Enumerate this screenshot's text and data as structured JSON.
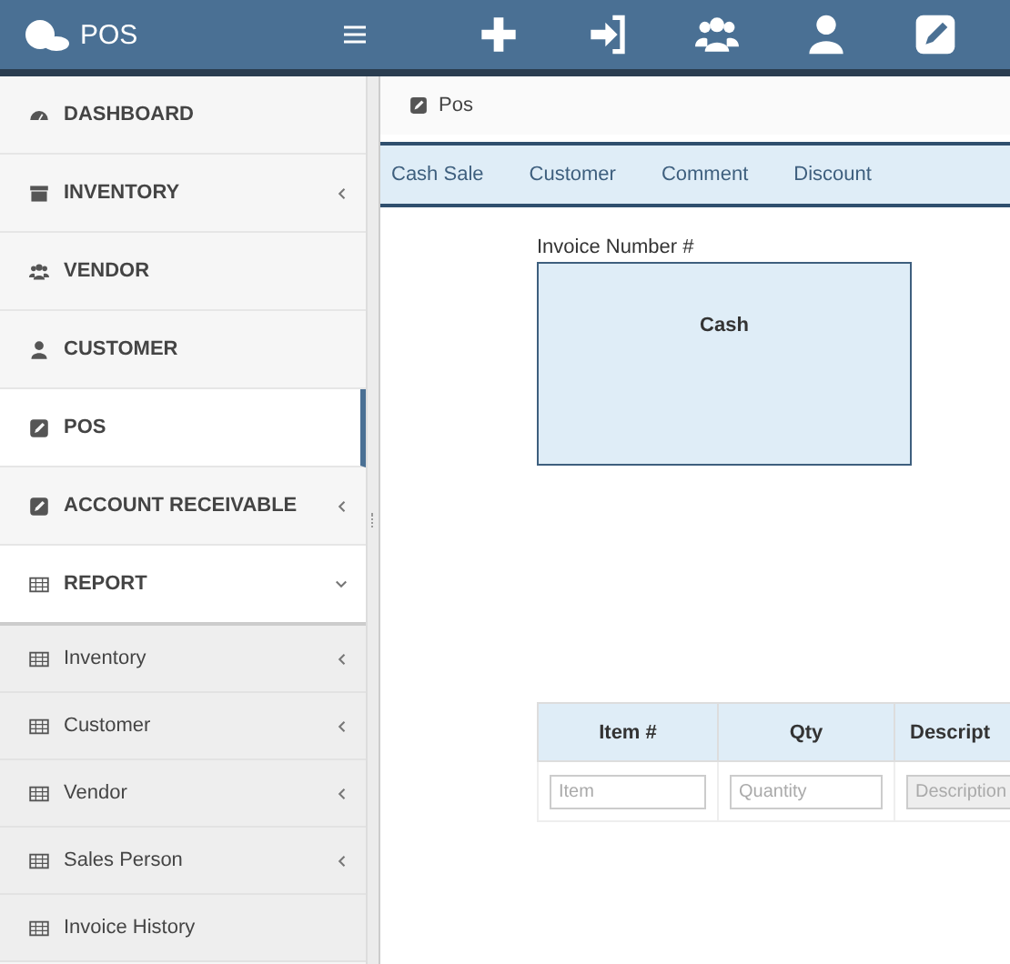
{
  "header": {
    "brand": "POS"
  },
  "sidebar": {
    "items": [
      {
        "label": "DASHBOARD",
        "selected": false,
        "submenu": false
      },
      {
        "label": "INVENTORY",
        "selected": false,
        "submenu": true,
        "expanded": false
      },
      {
        "label": "VENDOR",
        "selected": false,
        "submenu": false
      },
      {
        "label": "CUSTOMER",
        "selected": false,
        "submenu": false
      },
      {
        "label": "POS",
        "selected": true,
        "submenu": false
      },
      {
        "label": "ACCOUNT RECEIVABLE",
        "selected": false,
        "submenu": true,
        "expanded": false
      },
      {
        "label": "REPORT",
        "selected": false,
        "submenu": true,
        "expanded": true,
        "children": [
          {
            "label": "Inventory",
            "submenu": true
          },
          {
            "label": "Customer",
            "submenu": true
          },
          {
            "label": "Vendor",
            "submenu": true
          },
          {
            "label": "Sales Person",
            "submenu": true
          },
          {
            "label": "Invoice History",
            "submenu": false
          }
        ]
      }
    ]
  },
  "breadcrumb": "Pos",
  "tabs": [
    {
      "label": "Cash Sale"
    },
    {
      "label": "Customer"
    },
    {
      "label": "Comment"
    },
    {
      "label": "Discount"
    }
  ],
  "invoice": {
    "label": "Invoice Number #",
    "payment": "Cash"
  },
  "table": {
    "columns": [
      "Item #",
      "Qty",
      "Descript"
    ],
    "inputs": [
      {
        "placeholder": "Item",
        "disabled": false
      },
      {
        "placeholder": "Quantity",
        "disabled": false
      },
      {
        "placeholder": "Description",
        "disabled": true
      }
    ]
  }
}
